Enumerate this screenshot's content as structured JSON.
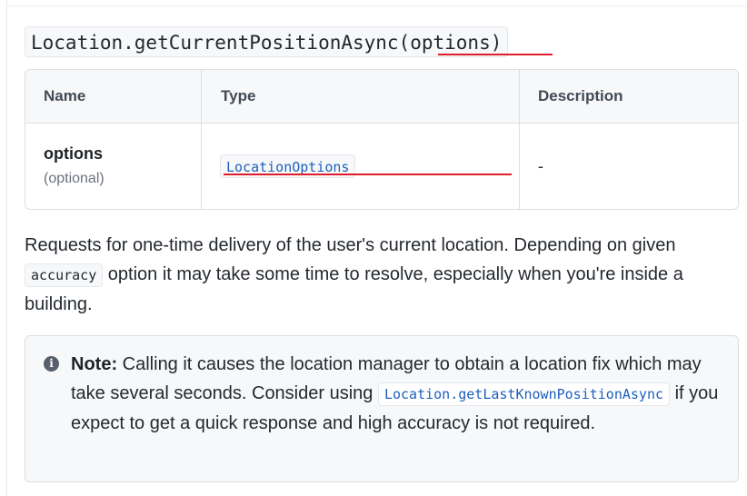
{
  "signature": {
    "text": "Location.getCurrentPositionAsync(options)"
  },
  "table": {
    "headers": {
      "name": "Name",
      "type": "Type",
      "description": "Description"
    },
    "rows": [
      {
        "name": "options",
        "qualifier": "(optional)",
        "type": "LocationOptions",
        "description": "-"
      }
    ]
  },
  "paragraph": {
    "before_code": "Requests for one-time delivery of the user's current location. Depending on given ",
    "code": "accuracy",
    "after_code": " option it may take some time to resolve, especially when you're inside a building."
  },
  "note": {
    "icon": "info-icon",
    "label": "Note:",
    "before_code": " Calling it causes the location manager to obtain a location fix which may take several seconds. Consider using ",
    "code": "Location.getLastKnownPositionAsync",
    "after_code": " if you expect to get a quick response and high accuracy is not required."
  },
  "colors": {
    "annotation": "#e11d2a",
    "link_code": "#1d5fbf",
    "code_background": "#f6f8fa"
  }
}
